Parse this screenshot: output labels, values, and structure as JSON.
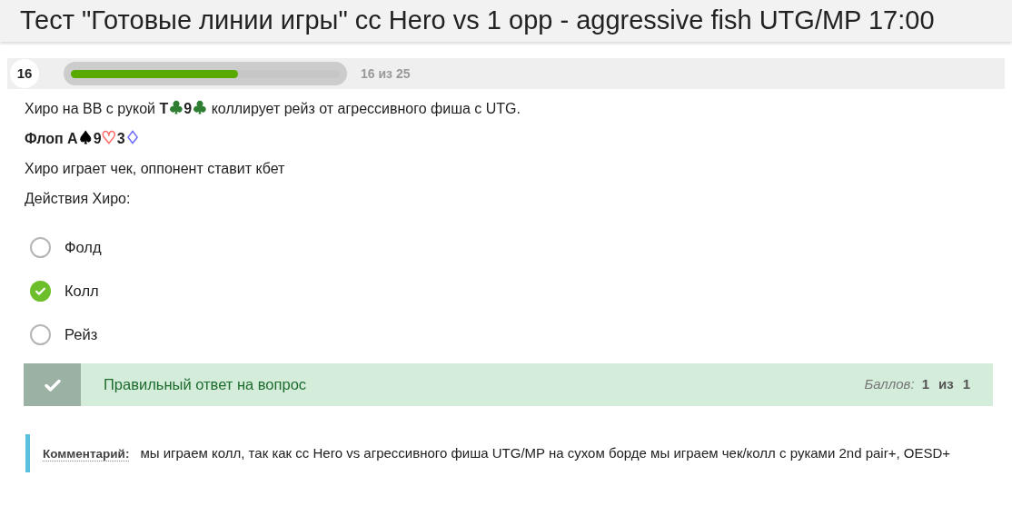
{
  "title": "Тест \"Готовые линии игры\" сс Hero vs 1 opp - aggressive fish UTG/MP 17:00",
  "progress": {
    "number": "16",
    "level": 0.62,
    "label": "16 из 25"
  },
  "question": [
    {
      "parts": [
        {
          "text": "Хиро на BB с рукой "
        },
        {
          "text": "T",
          "bold": true
        },
        {
          "text": "♣",
          "color": "#2e7d32"
        },
        {
          "text": "9",
          "bold": true
        },
        {
          "text": "♣",
          "color": "#2e7d32"
        },
        {
          "text": " коллирует рейз от агрессивного фиша с UTG."
        }
      ]
    },
    {
      "parts": [
        {
          "text": "Флоп A",
          "bold": true
        },
        {
          "text": "♠",
          "color": "#000000"
        },
        {
          "text": "9",
          "bold": true
        },
        {
          "text": "♡",
          "color": "#ff6b6b"
        },
        {
          "text": "3",
          "bold": true
        },
        {
          "text": "♢",
          "color": "#6b6bff"
        }
      ]
    },
    {
      "parts": [
        {
          "text": "Хиро играет чек, оппонент ставит кбет"
        }
      ]
    },
    {
      "parts": [
        {
          "text": "Действия Хиро:"
        }
      ]
    }
  ],
  "options": [
    {
      "label": "Фолд",
      "selected": false
    },
    {
      "label": "Колл",
      "selected": true
    },
    {
      "label": "Рейз",
      "selected": false
    }
  ],
  "feedback": {
    "correct": true,
    "message": "Правильный ответ на вопрос",
    "score_label": "Баллов:",
    "score": "1",
    "of": "из",
    "total": "1"
  },
  "comment": {
    "label": "Комментарий:",
    "text": "мы играем колл, так как сс Hero vs агрессивного фиша UTG/MP на сухом борде мы играем чек/колл с руками 2nd pair+, OESD+"
  }
}
